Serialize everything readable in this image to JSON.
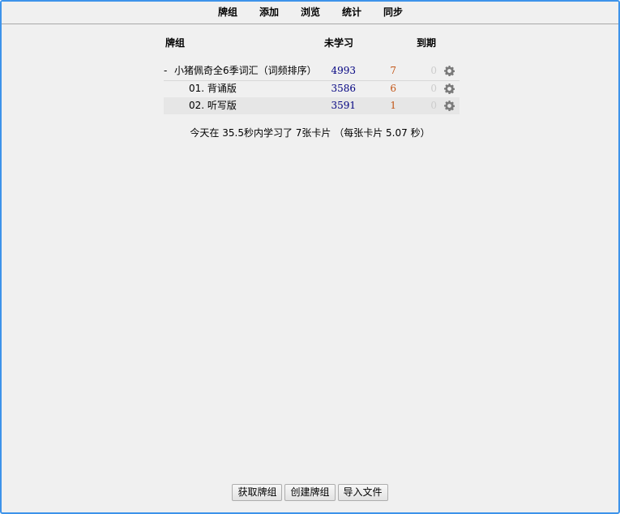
{
  "toolbar": {
    "tabs": [
      "牌组",
      "添加",
      "浏览",
      "统计",
      "同步"
    ]
  },
  "deck_table": {
    "headers": {
      "deck": "牌组",
      "new": "未学习",
      "due": "到期"
    },
    "rows": [
      {
        "expander": "-",
        "name": "小猪佩奇全6季词汇（词频排序）",
        "new": "4993",
        "learn": "7",
        "due": "0"
      },
      {
        "expander": "",
        "name": "01. 背诵版",
        "new": "3586",
        "learn": "6",
        "due": "0"
      },
      {
        "expander": "",
        "name": "02. 听写版",
        "new": "3591",
        "learn": "1",
        "due": "0"
      }
    ]
  },
  "study_summary": "今天在 35.5秒内学习了 7张卡片 （每张卡片 5.07 秒）",
  "buttons": {
    "get_shared": "获取牌组",
    "create_deck": "创建牌组",
    "import_file": "导入文件"
  },
  "colors": {
    "window_border": "#3d93ea",
    "background": "#f0f0f0",
    "new_count": "#000080",
    "learn_count": "#c35617",
    "due_count": "#cccccc",
    "gear": "#7a7a7a"
  }
}
